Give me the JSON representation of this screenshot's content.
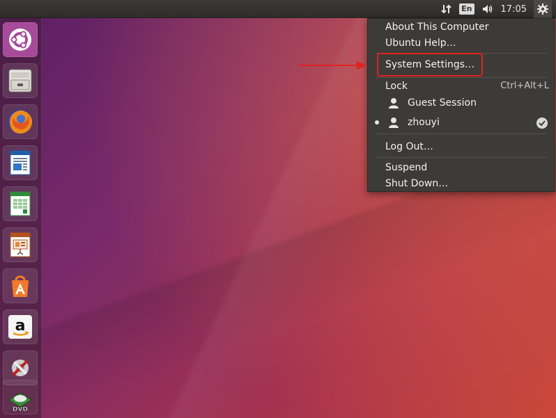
{
  "top_panel": {
    "language": "En",
    "time": "17:05",
    "icons": [
      "network-transfer-icon",
      "keyboard-language-indicator",
      "volume-icon",
      "session-gear-icon"
    ]
  },
  "launcher": {
    "items": [
      {
        "name": "ubuntu-dash-icon"
      },
      {
        "name": "file-cabinet-icon"
      },
      {
        "name": "firefox-icon"
      },
      {
        "name": "libreoffice-writer-icon"
      },
      {
        "name": "libreoffice-calc-icon"
      },
      {
        "name": "libreoffice-impress-icon"
      },
      {
        "name": "software-center-icon"
      },
      {
        "name": "amazon-icon"
      },
      {
        "name": "system-tools-icon"
      },
      {
        "name": "dvd-icon"
      }
    ],
    "icon_texts": {
      "amazon": "a",
      "dvd": "DVD"
    }
  },
  "session_menu": {
    "about": "About This Computer",
    "help": "Ubuntu Help…",
    "settings": "System Settings…",
    "lock": "Lock",
    "lock_shortcut": "Ctrl+Alt+L",
    "guest": "Guest Session",
    "user": "zhouyi",
    "logout": "Log Out…",
    "suspend": "Suspend",
    "shutdown": "Shut Down…"
  },
  "colors": {
    "highlight": "#e02121",
    "menu_bg": "#3c3b37",
    "panel_bg": "#2e2d2a"
  }
}
